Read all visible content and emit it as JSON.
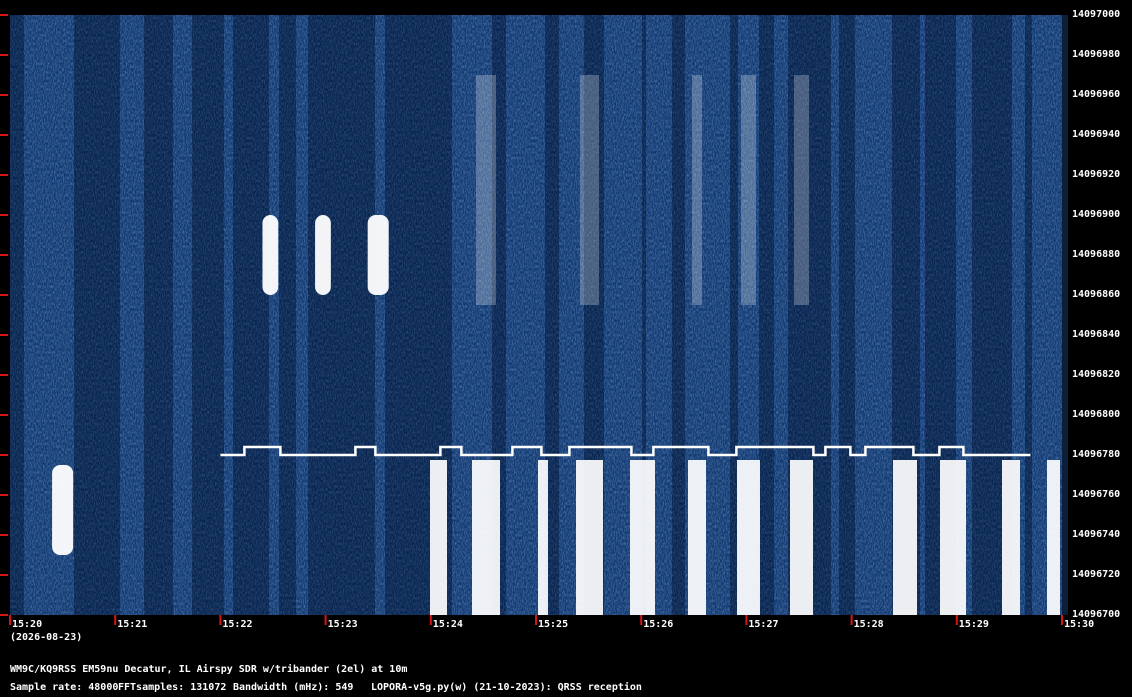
{
  "colors": {
    "background": "#000000",
    "waterfall_base": "#0b2a5a",
    "waterfall_mid": "#1f5aa0",
    "signal": "#ffffff",
    "tick": "#d81414",
    "text": "#ffffff"
  },
  "chart_data": {
    "type": "heatmap",
    "x_ticks": [
      "15:20",
      "15:21",
      "15:22",
      "15:23",
      "15:24",
      "15:25",
      "15:26",
      "15:27",
      "15:28",
      "15:29",
      "15:30"
    ],
    "y_ticks": [
      "14097000",
      "14096980",
      "14096960",
      "14096940",
      "14096920",
      "14096900",
      "14096880",
      "14096860",
      "14096840",
      "14096820",
      "14096800",
      "14096780",
      "14096760",
      "14096740",
      "14096720",
      "14096700"
    ],
    "xlim": [
      "15:20",
      "15:30"
    ],
    "ylim": [
      14096700,
      14097000
    ],
    "bright_bands_hz": [
      {
        "t_start": "15:20.4",
        "t_end": "15:20.6",
        "f_low": 14096730,
        "f_high": 14096775
      },
      {
        "t_start": "15:22.4",
        "t_end": "15:22.55",
        "f_low": 14096860,
        "f_high": 14096900
      },
      {
        "t_start": "15:22.9",
        "t_end": "15:23.05",
        "f_low": 14096860,
        "f_high": 14096900
      },
      {
        "t_start": "15:23.4",
        "t_end": "15:23.6",
        "f_low": 14096860,
        "f_high": 14096900
      }
    ],
    "wspr_trace": {
      "t_start": "15:22",
      "t_end": "15:29.7",
      "levels_hz": [
        14096780,
        14096784
      ]
    }
  },
  "date_label": "(2026-08-23)",
  "footer": {
    "line1": "WM9C/KQ9RSS EM59nu Decatur, IL  Airspy SDR w/tribander (2el) at 10m",
    "sample_rate": "Sample rate: 48000",
    "fft_samples": "FFTsamples: 131072",
    "bandwidth": "Bandwidth (mHz): 549",
    "software": "LOPORA-v5g.py(w) (21-10-2023): QRSS reception"
  }
}
